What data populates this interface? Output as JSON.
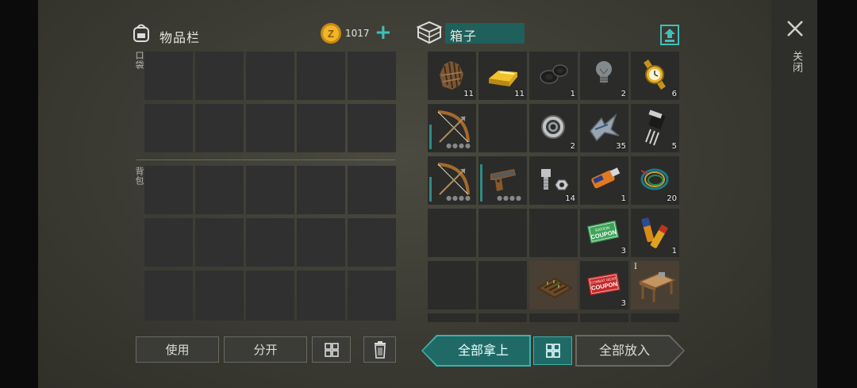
{
  "inventory": {
    "title": "物品栏",
    "coins": "1017",
    "add_symbol": "+",
    "pocket_label": "口袋",
    "backpack_label": "背包"
  },
  "box": {
    "title": "箱子",
    "slots": [
      {
        "item": "fur",
        "count": "11"
      },
      {
        "item": "gold-bar",
        "count": "11"
      },
      {
        "item": "rubber-seals",
        "count": "1"
      },
      {
        "item": "light-bulb",
        "count": "2"
      },
      {
        "item": "gold-watch",
        "count": "6"
      },
      {
        "item": "bow",
        "count": "",
        "durability": true
      },
      {
        "item": "",
        "count": ""
      },
      {
        "item": "bearing",
        "count": "2"
      },
      {
        "item": "metal-scraps",
        "count": "35"
      },
      {
        "item": "transistor",
        "count": "5"
      },
      {
        "item": "bow",
        "count": "",
        "durability": true
      },
      {
        "item": "flare-gun",
        "count": "",
        "durability": true
      },
      {
        "item": "bolts-nuts",
        "count": "14"
      },
      {
        "item": "usb-drive",
        "count": "1"
      },
      {
        "item": "wires",
        "count": "20"
      },
      {
        "item": "",
        "count": ""
      },
      {
        "item": "",
        "count": ""
      },
      {
        "item": "",
        "count": ""
      },
      {
        "item": "ration-coupon",
        "count": "3"
      },
      {
        "item": "batteries",
        "count": "1"
      },
      {
        "item": "",
        "count": ""
      },
      {
        "item": "",
        "count": ""
      },
      {
        "item": "seed-bed",
        "count": ""
      },
      {
        "item": "combat-coupon",
        "count": "3"
      },
      {
        "item": "workbench",
        "count": "",
        "tier": "I"
      }
    ],
    "coupon_ration_lines": [
      "RATION",
      "COUPON"
    ],
    "coupon_combat_lines": [
      "COMBAT GEAR",
      "COUPON"
    ]
  },
  "buttons": {
    "use": "使用",
    "split": "分开",
    "take_all": "全部拿上",
    "put_all": "全部放入"
  },
  "close_label": "关闭",
  "colors": {
    "accent": "#1f6a67",
    "accent_border": "#3fb0aa",
    "coin": "#e2a21a"
  }
}
